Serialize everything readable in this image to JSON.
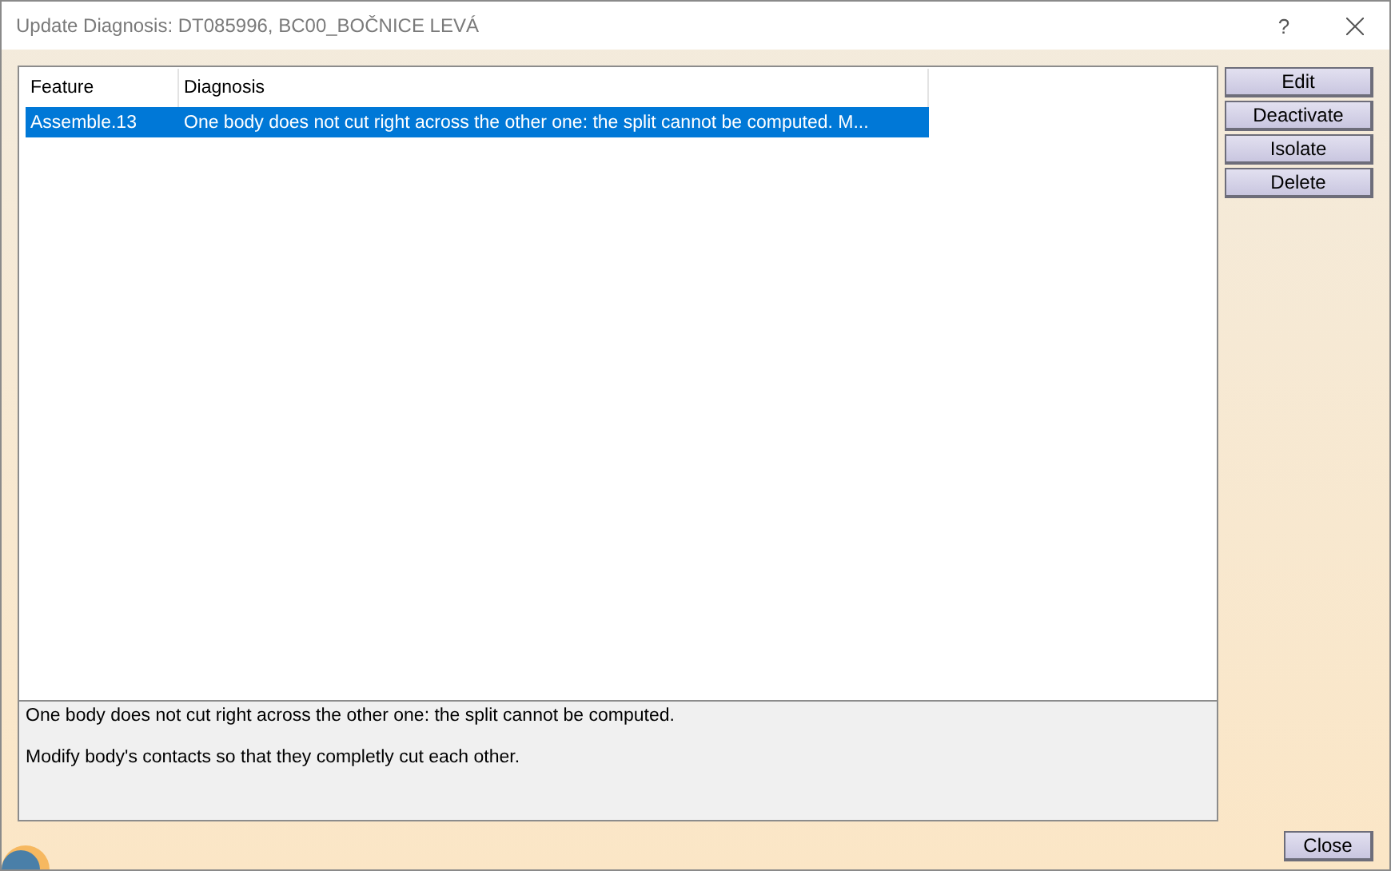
{
  "window": {
    "title": "Update Diagnosis: DT085996, BC00_BOČNICE LEVÁ",
    "help": "?"
  },
  "table": {
    "columns": [
      "Feature",
      "Diagnosis"
    ],
    "rows": [
      {
        "feature": "Assemble.13",
        "diagnosis": "One body does not cut right across the other one: the split cannot be computed.  M...",
        "selected": true
      }
    ]
  },
  "description": [
    "One body does not cut right across the other one: the split cannot be computed.",
    "Modify body's contacts so that they completly cut each other."
  ],
  "buttons": [
    "Edit",
    "Deactivate",
    "Isolate",
    "Delete"
  ],
  "close_button": "Close"
}
